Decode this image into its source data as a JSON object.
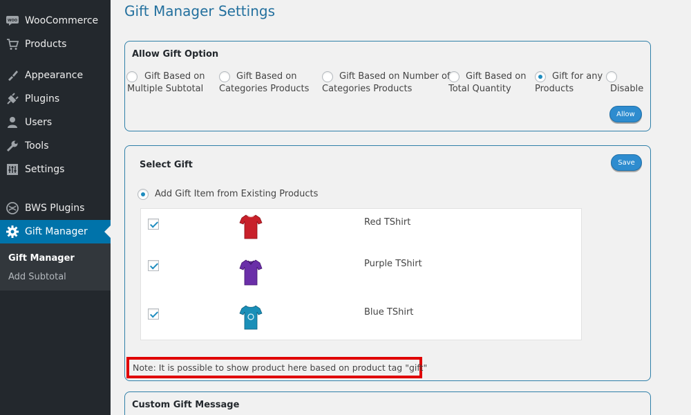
{
  "sidebar": {
    "items": [
      {
        "label": "WooCommerce",
        "icon": "woo-icon"
      },
      {
        "label": "Products",
        "icon": "cart-icon"
      },
      {
        "label": "Appearance",
        "icon": "brush-icon"
      },
      {
        "label": "Plugins",
        "icon": "plug-icon"
      },
      {
        "label": "Users",
        "icon": "user-icon"
      },
      {
        "label": "Tools",
        "icon": "wrench-icon"
      },
      {
        "label": "Settings",
        "icon": "settings-icon"
      },
      {
        "label": "BWS Plugins",
        "icon": "bws-icon"
      },
      {
        "label": "Gift Manager",
        "icon": "gear-icon"
      }
    ],
    "submenu": [
      "Gift Manager",
      "Add Subtotal"
    ],
    "colors": {
      "bg": "#23282d",
      "active": "#0073aa",
      "submenu_bg": "#32373c"
    }
  },
  "page": {
    "title": "Gift Manager Settings"
  },
  "allow_gift": {
    "title": "Allow Gift Option",
    "options": [
      {
        "line1": "Gift Based on",
        "line2": "Multiple Subtotal",
        "checked": false
      },
      {
        "line1": "Gift Based on",
        "line2": "Categories Products",
        "checked": false
      },
      {
        "line1": "Gift Based on Number of",
        "line2": "Categories Products",
        "checked": false
      },
      {
        "line1": "Gift Based on",
        "line2": "Total Quantity",
        "checked": false
      },
      {
        "line1": "Gift for any",
        "line2": "Products",
        "checked": true
      },
      {
        "line1": "",
        "line2": "Disable",
        "checked": false
      }
    ],
    "button": "Allow"
  },
  "select_gift": {
    "title": "Select Gift",
    "save_button": "Save",
    "source_option": "Add Gift Item from Existing Products",
    "products": [
      {
        "name": "Red TShirt",
        "color": "#c8202a",
        "checked": true
      },
      {
        "name": "Purple TShirt",
        "color": "#6a2fa8",
        "checked": true
      },
      {
        "name": "Blue TShirt",
        "color": "#1a8fb8",
        "checked": true
      }
    ],
    "note": "Note: It is possible to show product here based on product tag \"gift\""
  },
  "custom_message": {
    "title": "Custom Gift Message"
  },
  "colors": {
    "accent": "#2e8ccf",
    "title": "#23709e",
    "note_border": "#e00000"
  }
}
